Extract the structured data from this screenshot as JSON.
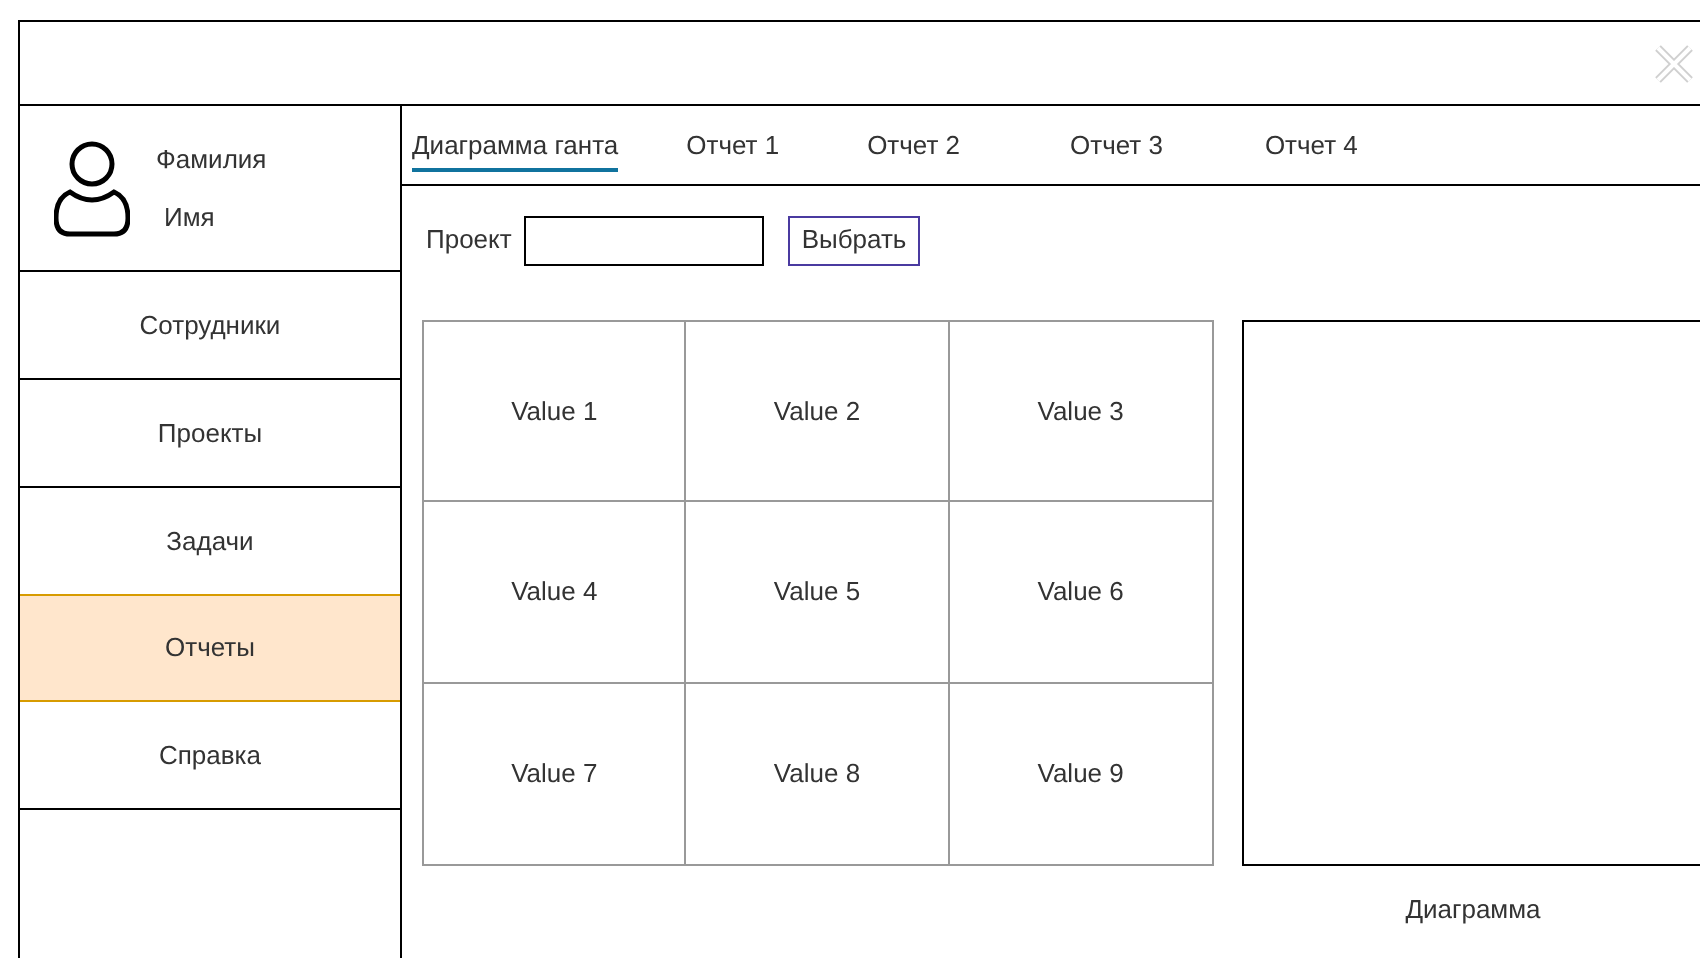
{
  "user": {
    "last_name": "Фамилия",
    "first_name": "Имя"
  },
  "sidebar": {
    "items": [
      {
        "label": "Сотрудники",
        "selected": false
      },
      {
        "label": "Проекты",
        "selected": false
      },
      {
        "label": "Задачи",
        "selected": false
      },
      {
        "label": "Отчеты",
        "selected": true
      },
      {
        "label": "Справка",
        "selected": false
      }
    ]
  },
  "tabs": [
    {
      "label": "Диаграмма ганта",
      "selected": true
    },
    {
      "label": "Отчет 1",
      "selected": false
    },
    {
      "label": "Отчет 2",
      "selected": false
    },
    {
      "label": "Отчет 3",
      "selected": false
    },
    {
      "label": "Отчет 4",
      "selected": false
    }
  ],
  "project": {
    "label": "Проект",
    "button": "Выбрать"
  },
  "table": {
    "rows": [
      [
        "Value 1",
        "Value 2",
        "Value 3"
      ],
      [
        "Value 4",
        "Value 5",
        "Value 6"
      ],
      [
        "Value 7",
        "Value 8",
        "Value 9"
      ]
    ]
  },
  "diagram": {
    "caption": "Диаграмма"
  }
}
